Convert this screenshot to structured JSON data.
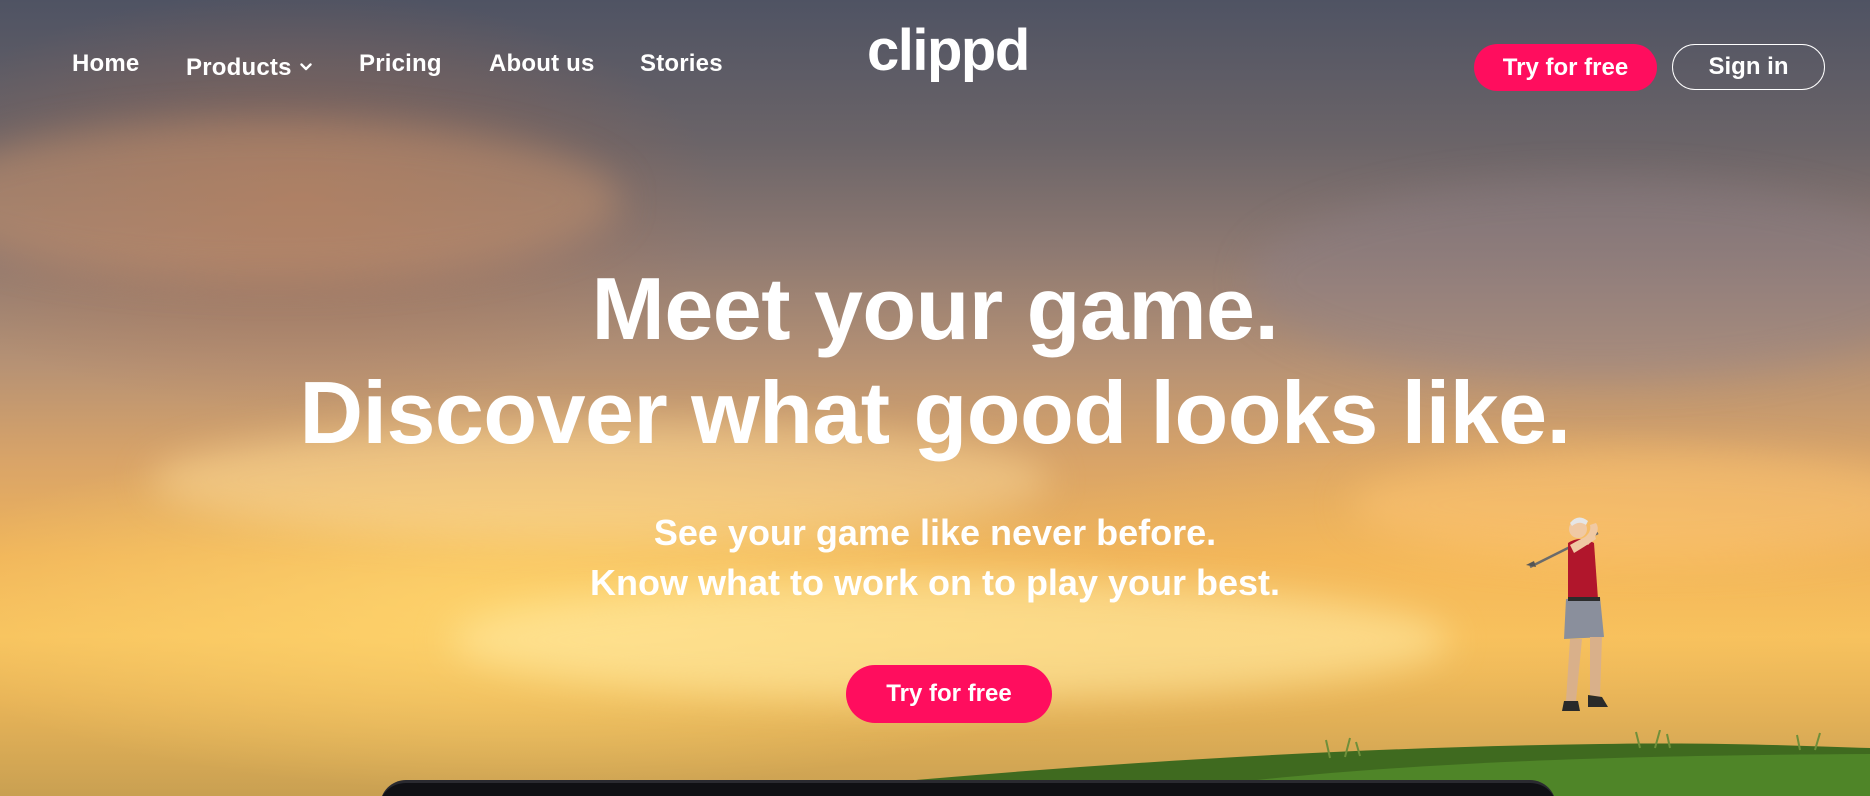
{
  "nav": {
    "links": [
      {
        "label": "Home"
      },
      {
        "label": "Products"
      },
      {
        "label": "Pricing"
      },
      {
        "label": "About us"
      },
      {
        "label": "Stories"
      }
    ],
    "logo_text": "clippd",
    "try_label": "Try for free",
    "signin_label": "Sign in"
  },
  "hero": {
    "headline_line1": "Meet your game.",
    "headline_line2": "Discover what good looks like.",
    "sub_line1": "See your game like never before.",
    "sub_line2": "Know what to work on to play your best.",
    "cta_label": "Try for free"
  },
  "colors": {
    "accent": "#ff0d5e",
    "text": "#ffffff"
  },
  "icons": {
    "products_dropdown": "chevron-down-icon"
  }
}
